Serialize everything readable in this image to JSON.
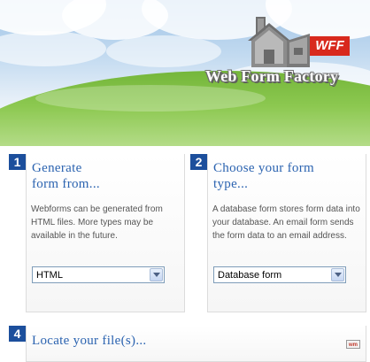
{
  "header": {
    "badge_text": "WFF",
    "brand_name": "Web Form Factory",
    "colors": {
      "badge": "#d8291d",
      "grass": "#8cc850",
      "sky": "#c2daf0"
    }
  },
  "steps": [
    {
      "number": "1",
      "heading_line1": "Generate",
      "heading_line2": "form from...",
      "description": "Webforms can be generated from HTML files. More types may be available in the future.",
      "select_value": "HTML"
    },
    {
      "number": "2",
      "heading_line1": "Choose your form",
      "heading_line2": "type...",
      "description": "A database form stores form data into your database. An email form sends the form data to an email address.",
      "select_value": "Database form"
    },
    {
      "number": "4",
      "heading_line1": "Locate your file(s)..."
    }
  ],
  "footer_badge": "wm",
  "icons": {
    "logo": "factory-icon",
    "dropdown": "chevron-down-icon"
  },
  "accent_color": "#2b63b0",
  "step_number_color": "#1c4f9c"
}
